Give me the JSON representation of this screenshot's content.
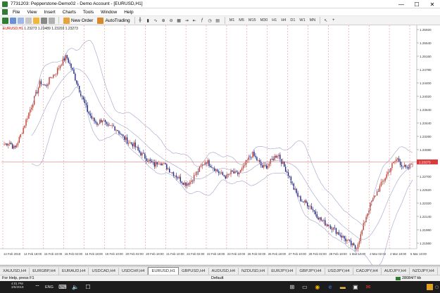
{
  "window": {
    "title": "7731203: Pepperstone-Demo02 - Demo Account - [EURUSD,H1]",
    "minimize": "—",
    "maximize": "☐",
    "close": "✕"
  },
  "menu": [
    "File",
    "View",
    "Insert",
    "Charts",
    "Tools",
    "Window",
    "Help"
  ],
  "toolbar": {
    "new_order": "New Order",
    "autotrading": "AutoTrading",
    "timeframes": [
      "M1",
      "M5",
      "M15",
      "M30",
      "H1",
      "H4",
      "D1",
      "W1",
      "MN"
    ]
  },
  "chart": {
    "symbol_label": "EURUSD,H1",
    "ohlc_label": "1.23273 1.23489 1.23203 1.23273",
    "bid_price": "1.23273",
    "bid_color": "#d93c3c",
    "up_color": "#c0392b",
    "down_color": "#1a237e",
    "band_color": "#9ea3c9",
    "separator_color": "#e08080"
  },
  "chart_data": {
    "type": "candlestick",
    "symbol": "EURUSD",
    "timeframe": "H1",
    "y_ticks": [
      "1.25920",
      "1.25540",
      "1.25160",
      "1.24780",
      "1.24400",
      "1.24020",
      "1.23640",
      "1.23440",
      "1.23260",
      "1.23080",
      "1.22900",
      "1.22700",
      "1.22520",
      "1.22320",
      "1.22140",
      "1.21960",
      "1.21560"
    ],
    "x_ticks": [
      "14 Feb 2018",
      "14 Feb 18:00",
      "15 Feb 10:00",
      "16 Feb 02:00",
      "16 Feb 18:00",
      "19 Feb 10:00",
      "20 Feb 02:00",
      "20 Feb 18:00",
      "21 Feb 10:00",
      "22 Feb 02:00",
      "22 Feb 18:00",
      "23 Feb 10:00",
      "26 Feb 02:00",
      "26 Feb 18:00",
      "27 Feb 10:00",
      "28 Feb 02:00",
      "28 Feb 18:00",
      "1 Mar 10:00",
      "2 Mar 02:00",
      "2 Mar 18:00",
      "5 Mar 10:00"
    ],
    "price_path": [
      1.2365,
      1.237,
      1.2355,
      1.238,
      1.241,
      1.244,
      1.247,
      1.25,
      1.249,
      1.251,
      1.252,
      1.254,
      1.2555,
      1.253,
      1.25,
      1.247,
      1.244,
      1.242,
      1.241,
      1.242,
      1.24,
      1.2405,
      1.2395,
      1.238,
      1.237,
      1.2365,
      1.235,
      1.234,
      1.233,
      1.232,
      1.233,
      1.232,
      1.231,
      1.23,
      1.229,
      1.228,
      1.2285,
      1.23,
      1.2315,
      1.233,
      1.232,
      1.231,
      1.23,
      1.2295,
      1.2305,
      1.23,
      1.231,
      1.233,
      1.2345,
      1.233,
      1.2315,
      1.232,
      1.2335,
      1.2345,
      1.232,
      1.23,
      1.227,
      1.225,
      1.224,
      1.2235,
      1.222,
      1.2205,
      1.2195,
      1.219,
      1.218,
      1.217,
      1.216,
      1.215,
      1.214,
      1.217,
      1.221,
      1.224,
      1.226,
      1.228,
      1.23,
      1.232,
      1.2335,
      1.232,
      1.231,
      1.2327
    ]
  },
  "tabs": [
    "XAUUSD,H4",
    "EURGBP,H4",
    "EURAUD,H4",
    "USDCAD,H4",
    "USDCHF,H4",
    "EURUSD,H1",
    "GBPUSD,H4",
    "AUDUSD,H4",
    "NZDUSD,H4",
    "EURJPY,H4",
    "GBPJPY,H4",
    "USDJPY,H4",
    "CADJPY,H4",
    "AUDJPY,H4",
    "NZDJPY,H4"
  ],
  "active_tab": "EURUSD,H1",
  "status": {
    "help": "For Help, press F1",
    "profile": "Default",
    "traffic": "28084/7 kb"
  },
  "taskbar": {
    "time": "4:01 PM",
    "date": "3/5/2018",
    "lang": "ENG"
  }
}
